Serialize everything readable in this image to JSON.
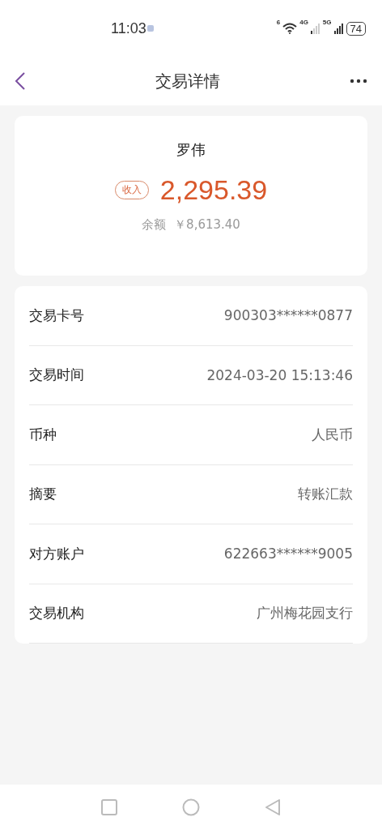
{
  "status_bar": {
    "time": "11:03",
    "wifi_label": "6",
    "network_1": "4G",
    "network_2": "5G",
    "battery": "74"
  },
  "header": {
    "title": "交易详情"
  },
  "summary": {
    "name": "罗伟",
    "tag": "收入",
    "amount": "2,295.39",
    "balance_label": "余额",
    "balance": "￥8,613.40"
  },
  "details": [
    {
      "label": "交易卡号",
      "value": "900303******0877"
    },
    {
      "label": "交易时间",
      "value": "2024-03-20 15:13:46"
    },
    {
      "label": "币种",
      "value": "人民币"
    },
    {
      "label": "摘要",
      "value": "转账汇款"
    },
    {
      "label": "对方账户",
      "value": "622663******9005"
    },
    {
      "label": "交易机构",
      "value": "广州梅花园支行"
    }
  ]
}
